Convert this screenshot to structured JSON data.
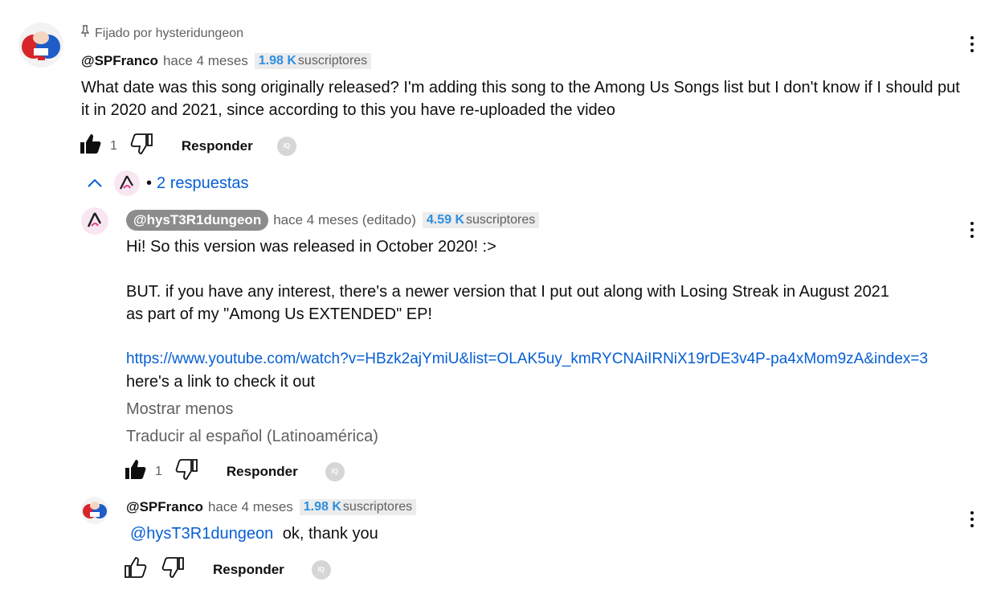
{
  "pinned": {
    "text": "Fijado por hysteridungeon"
  },
  "comment": {
    "handle": "@SPFranco",
    "time": "hace 4 meses",
    "subs_count": "1.98 K",
    "subs_label": "suscriptores",
    "text_line1": "What date was this song originally released? I'm adding this song to the Among Us Songs list but I don't know if I should put",
    "text_line2": "it in 2020 and 2021, since according to this you have re-uploaded the video",
    "likes": "1",
    "reply_label": "Responder",
    "iq_label": "IQ"
  },
  "replies_toggle": {
    "label": "2 respuestas",
    "bullet": "•"
  },
  "reply1": {
    "handle": "@hysT3R1dungeon",
    "time": "hace 4 meses (editado)",
    "subs_count": "4.59 K",
    "subs_label": "suscriptores",
    "line1": "Hi! So this version was released in October 2020! :>",
    "line2": "BUT. if you have any interest, there's a newer version that I put out along with Losing Streak in August 2021",
    "line3": "as part of my \"Among Us EXTENDED\" EP!",
    "url": "https://www.youtube.com/watch?v=HBzk2ajYmiU&list=OLAK5uy_kmRYCNAiIRNiX19rDE3v4P-pa4xMom9zA&index=3",
    "line4": "here's a link to check it out",
    "show_less": "Mostrar menos",
    "translate": "Traducir al español (Latinoamérica)",
    "likes": "1",
    "reply_label": "Responder",
    "iq_label": "IQ"
  },
  "reply2": {
    "handle": "@SPFranco",
    "time": "hace 4 meses",
    "subs_count": "1.98 K",
    "subs_label": "suscriptores",
    "mention": "@hysT3R1dungeon",
    "text": "ok, thank you",
    "reply_label": "Responder",
    "iq_label": "IQ"
  },
  "colors": {
    "link": "#065fd4",
    "subs_count": "#2e8fe0",
    "secondary": "#606060"
  }
}
